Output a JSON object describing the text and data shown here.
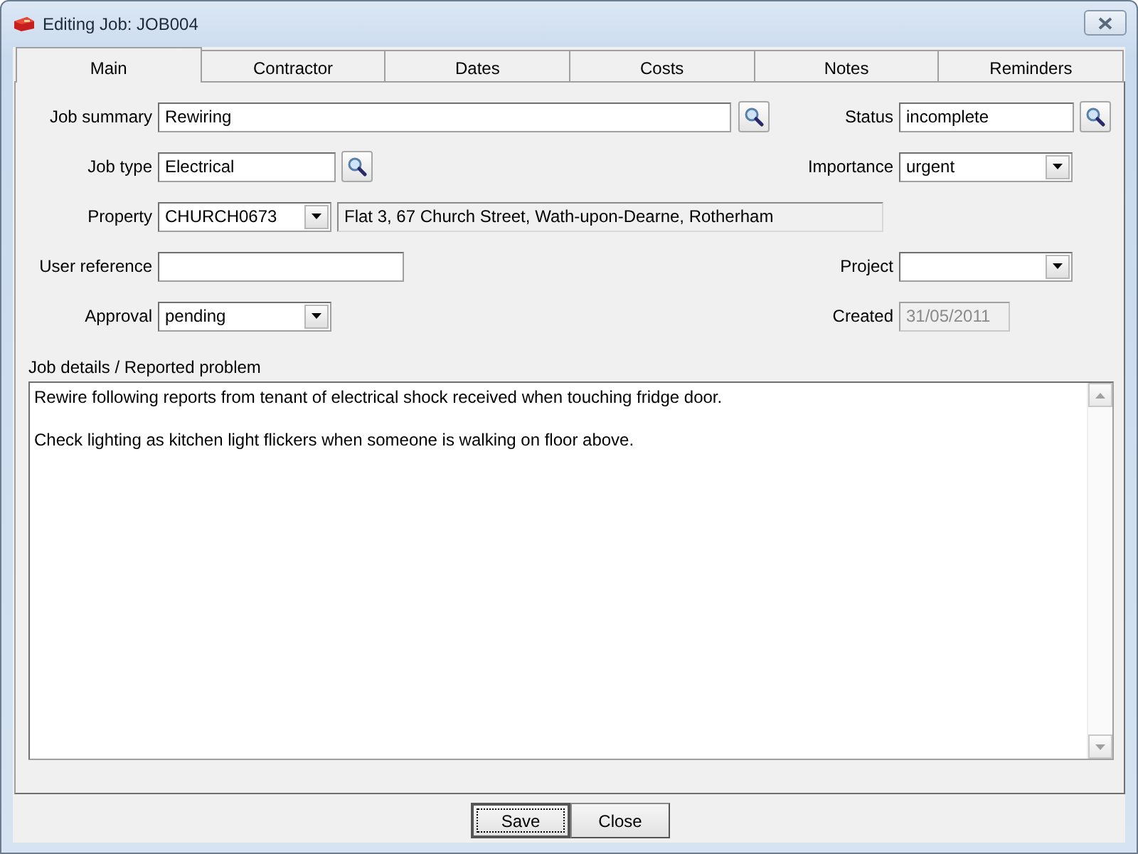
{
  "window": {
    "title": "Editing Job: JOB004"
  },
  "tabs": [
    {
      "label": "Main",
      "selected": true
    },
    {
      "label": "Contractor",
      "selected": false
    },
    {
      "label": "Dates",
      "selected": false
    },
    {
      "label": "Costs",
      "selected": false
    },
    {
      "label": "Notes",
      "selected": false
    },
    {
      "label": "Reminders",
      "selected": false
    }
  ],
  "rows": [
    {
      "left": {
        "label": "Job summary",
        "kind": "lookup",
        "value": "Rewiring"
      },
      "right": {
        "label": "Status",
        "kind": "lookup",
        "value": "incomplete"
      }
    },
    {
      "left": {
        "label": "Job type",
        "kind": "lookup",
        "value": "Electrical"
      },
      "right": {
        "label": "Importance",
        "kind": "combo",
        "value": "urgent"
      }
    },
    {
      "left": {
        "label": "Property",
        "kind": "combo",
        "value": "CHURCH0673",
        "description": "Flat 3, 67 Church Street, Wath-upon-Dearne, Rotherham"
      }
    },
    {
      "left": {
        "label": "User reference",
        "kind": "text"
      },
      "right": {
        "label": "Project",
        "kind": "combo"
      }
    },
    {
      "left": {
        "label": "Approval",
        "kind": "combo",
        "value": "pending"
      },
      "right": {
        "label": "Created",
        "kind": "text",
        "value": "31/05/2011",
        "disabled": true
      }
    }
  ],
  "details": {
    "label": "Job details / Reported problem",
    "value": "Rewire following reports from tenant of electrical shock received when touching fridge door.\n\nCheck lighting as kitchen light flickers when someone is walking on floor above."
  },
  "buttons": [
    {
      "label": "Save",
      "focused": true
    },
    {
      "label": "Close",
      "focused": false
    }
  ]
}
